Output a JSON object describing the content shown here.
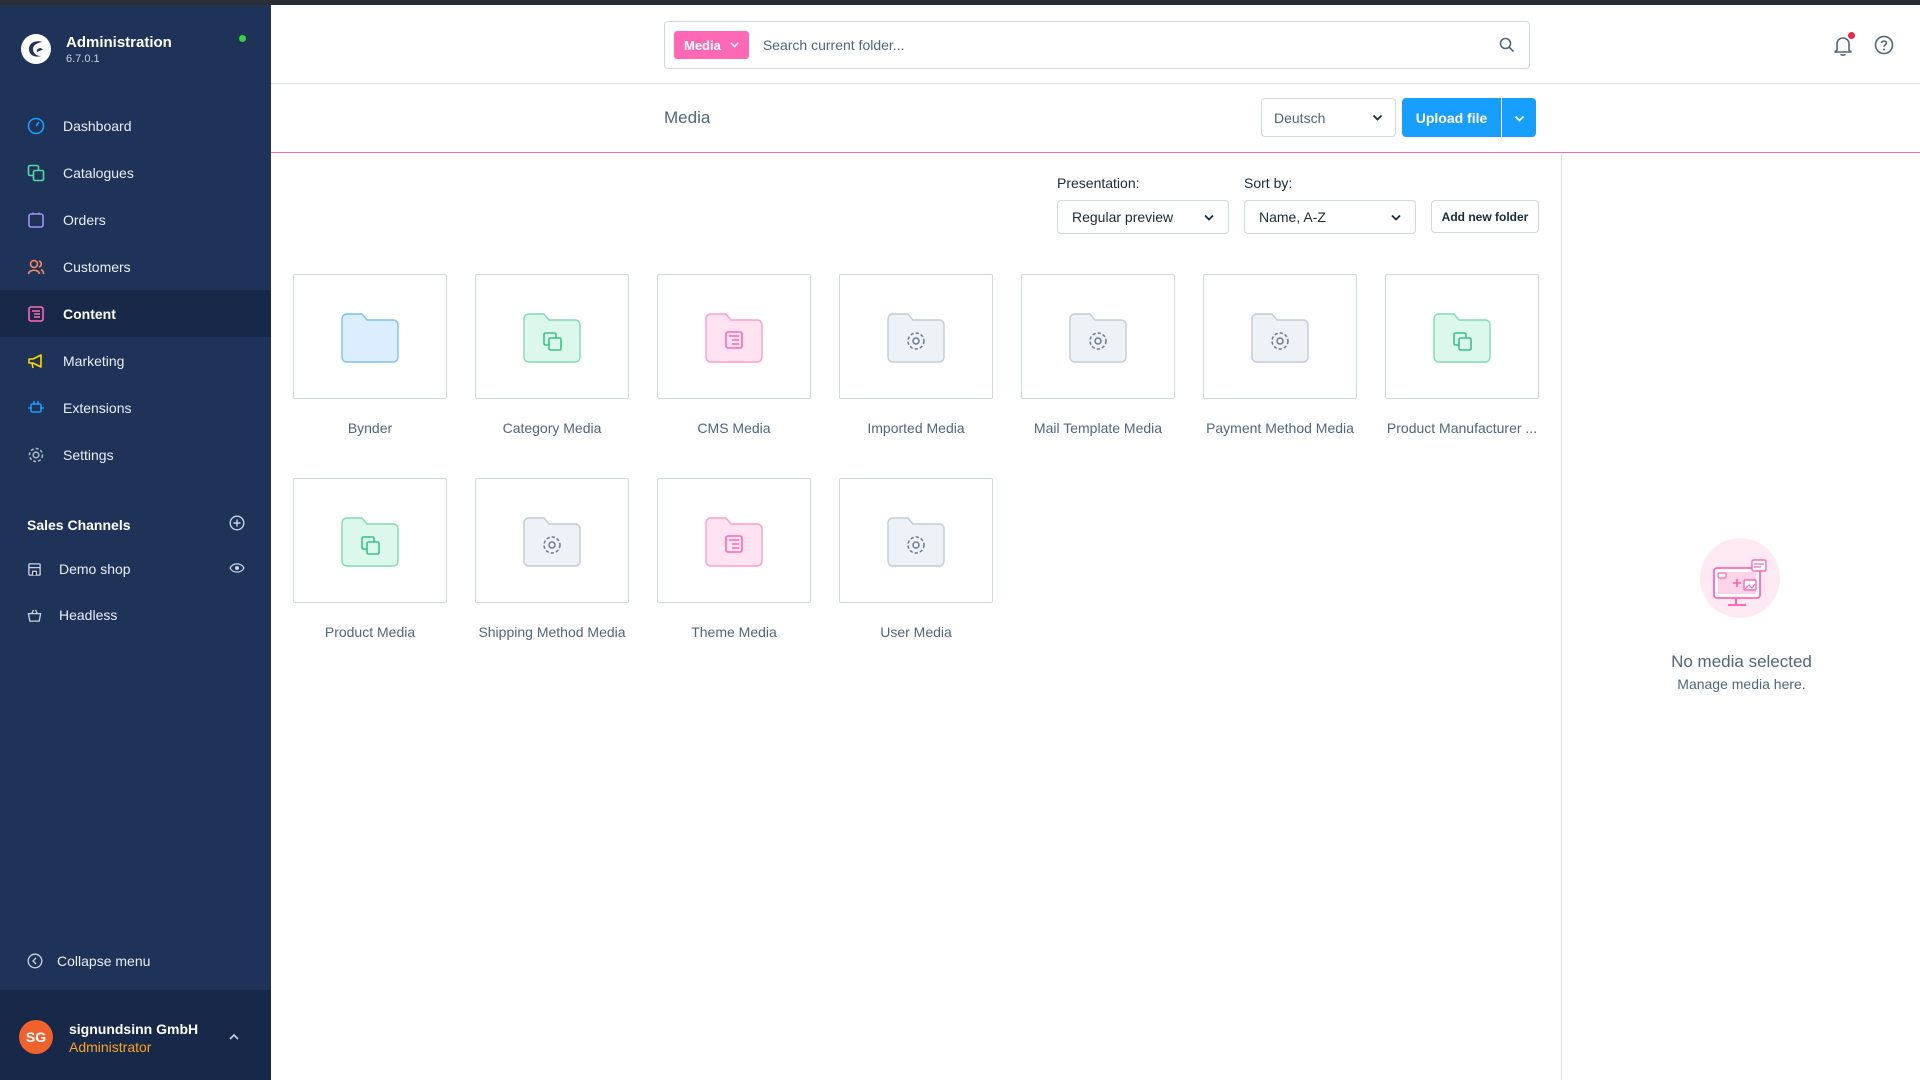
{
  "app": {
    "title": "Administration",
    "version": "6.7.0.1"
  },
  "nav": [
    {
      "label": "Dashboard",
      "icon": "dashboard-icon"
    },
    {
      "label": "Catalogues",
      "icon": "catalogues-icon"
    },
    {
      "label": "Orders",
      "icon": "orders-icon"
    },
    {
      "label": "Customers",
      "icon": "customers-icon"
    },
    {
      "label": "Content",
      "icon": "content-icon",
      "active": true
    },
    {
      "label": "Marketing",
      "icon": "marketing-icon"
    },
    {
      "label": "Extensions",
      "icon": "extensions-icon"
    },
    {
      "label": "Settings",
      "icon": "settings-icon"
    }
  ],
  "sales_channels": {
    "header": "Sales Channels",
    "items": [
      {
        "label": "Demo shop",
        "icon": "storefront-icon"
      },
      {
        "label": "Headless",
        "icon": "basket-icon"
      }
    ]
  },
  "sidebar_footer": {
    "collapse_label": "Collapse menu",
    "user_initials": "SG",
    "user_name": "signundsinn GmbH",
    "user_role": "Administrator"
  },
  "search": {
    "context": "Media",
    "placeholder": "Search current folder..."
  },
  "page": {
    "title": "Media",
    "language": "Deutsch",
    "upload_label": "Upload file"
  },
  "toolbar": {
    "presentation_label": "Presentation:",
    "presentation_value": "Regular preview",
    "sort_label": "Sort by:",
    "sort_value": "Name, A-Z",
    "add_folder_label": "Add new folder"
  },
  "folders": [
    {
      "name": "Bynder",
      "type": "default"
    },
    {
      "name": "Category Media",
      "type": "green"
    },
    {
      "name": "CMS Media",
      "type": "pink"
    },
    {
      "name": "Imported Media",
      "type": "gear"
    },
    {
      "name": "Mail Template Media",
      "type": "gear"
    },
    {
      "name": "Payment Method Media",
      "type": "gear"
    },
    {
      "name": "Product Manufacturer ...",
      "type": "green"
    },
    {
      "name": "Product Media",
      "type": "green"
    },
    {
      "name": "Shipping Method Media",
      "type": "gear"
    },
    {
      "name": "Theme Media",
      "type": "pink"
    },
    {
      "name": "User Media",
      "type": "gear"
    }
  ],
  "sidebar_panel": {
    "empty_title": "No media selected",
    "empty_subtitle": "Manage media here."
  },
  "colors": {
    "sidebar_bg": "#1f3258",
    "accent_pink": "#ff68b4",
    "primary_blue": "#189eff",
    "avatar_orange": "#f0622d",
    "role_orange": "#f7a524"
  }
}
